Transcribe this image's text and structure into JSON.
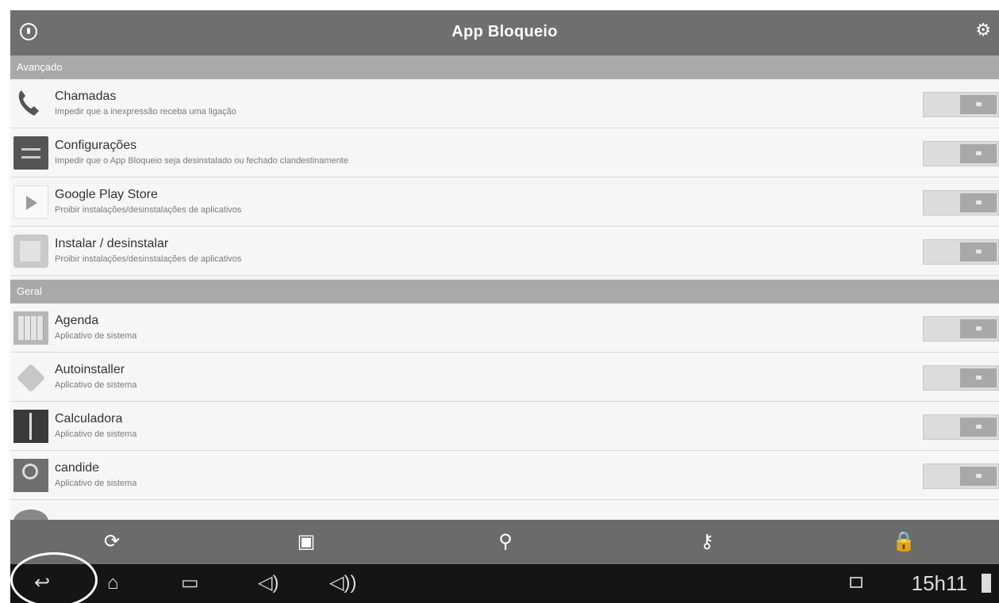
{
  "titlebar": {
    "title": "App Bloqueio"
  },
  "sections": {
    "advanced": "Avançado",
    "general": "Geral"
  },
  "advanced_items": [
    {
      "name": "Chamadas",
      "desc": "Impedir que a inexpressão receba uma ligação",
      "icon": "phone-icon",
      "enabled": true
    },
    {
      "name": "Configurações",
      "desc": "Impedir que o App Bloqueio seja desinstalado ou fechado clandestinamente",
      "icon": "settings-icon",
      "enabled": true
    },
    {
      "name": "Google Play Store",
      "desc": "Proibir instalações/desinstalações de aplicativos",
      "icon": "play-store-icon",
      "enabled": true
    },
    {
      "name": "Instalar / desinstalar",
      "desc": "Proibir instalações/desinstalações de aplicativos",
      "icon": "installer-icon",
      "enabled": true
    }
  ],
  "general_items": [
    {
      "name": "Agenda",
      "desc": "Aplicativo de sistema",
      "icon": "calendar-icon",
      "enabled": true
    },
    {
      "name": "Autoinstaller",
      "desc": "Aplicativo de sistema",
      "icon": "package-icon",
      "enabled": true
    },
    {
      "name": "Calculadora",
      "desc": "Aplicativo de sistema",
      "icon": "calculator-icon",
      "enabled": true
    },
    {
      "name": "candide",
      "desc": "Aplicativo de sistema",
      "icon": "candide-icon",
      "enabled": true
    }
  ],
  "statusbar": {
    "time": "15h11"
  }
}
